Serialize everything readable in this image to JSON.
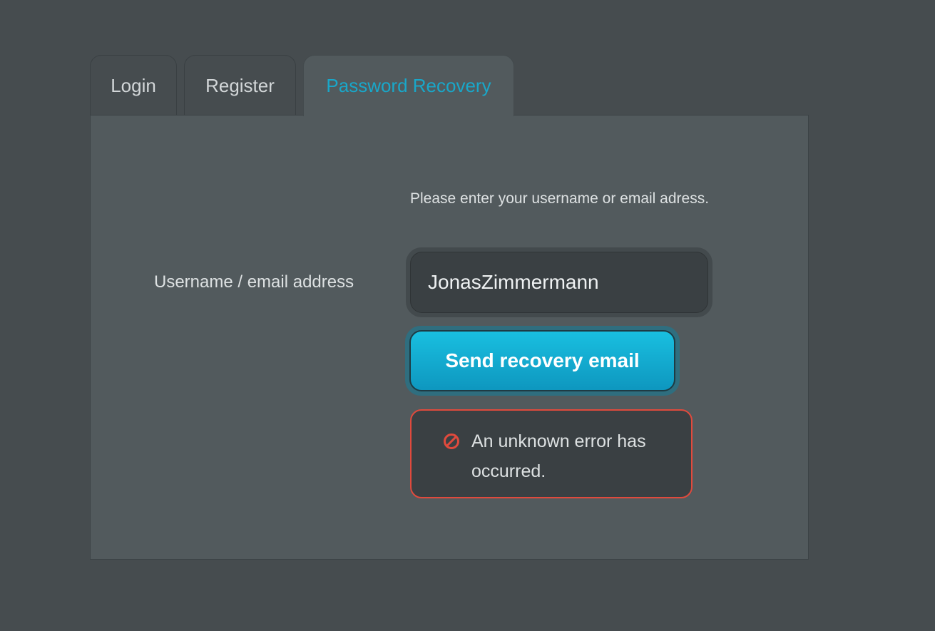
{
  "tabs": [
    {
      "label": "Login",
      "active": false
    },
    {
      "label": "Register",
      "active": false
    },
    {
      "label": "Password Recovery",
      "active": true
    }
  ],
  "recovery": {
    "instruction": "Please enter your username or email adress.",
    "field_label": "Username / email address",
    "field_value": "JonasZimmermann",
    "submit_label": "Send recovery email",
    "error": {
      "icon": "prohibited-icon",
      "message": "An unknown error has occurred."
    }
  },
  "colors": {
    "background": "#464c4f",
    "panel": "#525a5d",
    "accent": "#19a7c9",
    "button": "#12aed3",
    "error": "#e04a3d"
  }
}
